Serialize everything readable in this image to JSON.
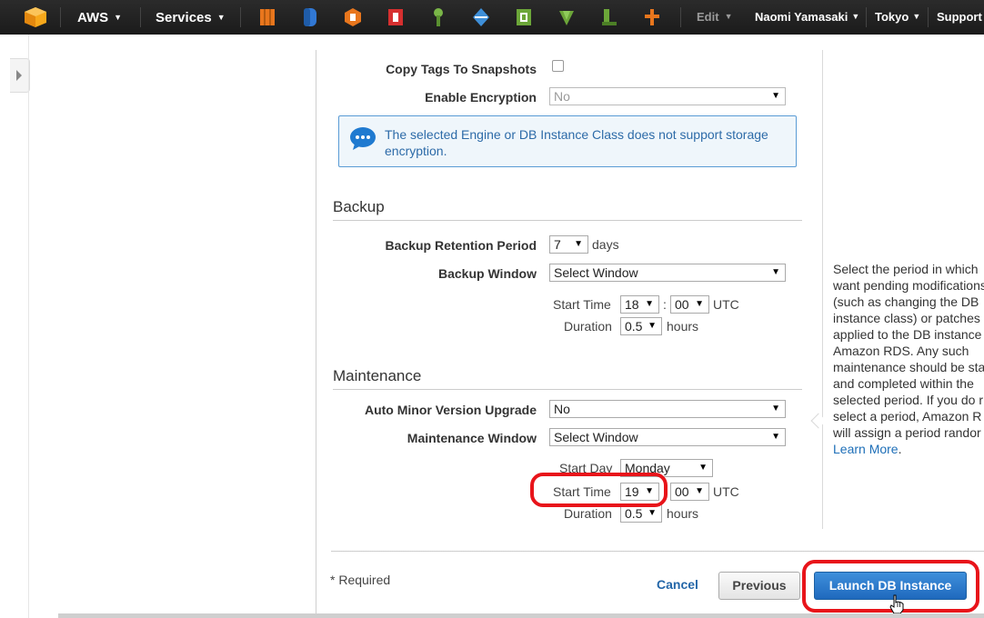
{
  "topnav": {
    "brand": "AWS",
    "services": "Services",
    "edit": "Edit",
    "user": "Naomi Yamasaki",
    "region": "Tokyo",
    "support": "Support"
  },
  "storage": {
    "copy_tags_label": "Copy Tags To Snapshots",
    "encryption_label": "Enable Encryption",
    "encryption_value": "No",
    "info_message": "The selected Engine or DB Instance Class does not support storage encryption."
  },
  "backup": {
    "title": "Backup",
    "retention_label": "Backup Retention Period",
    "retention_value": "7",
    "retention_unit": "days",
    "window_label": "Backup Window",
    "window_value": "Select Window",
    "start_time_label": "Start Time",
    "start_hour": "18",
    "start_minute": "00",
    "tz": "UTC",
    "duration_label": "Duration",
    "duration_value": "0.5",
    "duration_unit": "hours",
    "colon": ":"
  },
  "maintenance": {
    "title": "Maintenance",
    "auto_minor_label": "Auto Minor Version Upgrade",
    "auto_minor_value": "No",
    "window_label": "Maintenance Window",
    "window_value": "Select Window",
    "start_day_label": "Start Day",
    "start_day_value": "Monday",
    "start_time_label": "Start Time",
    "start_hour": "19",
    "start_minute": "00",
    "tz": "UTC",
    "duration_label": "Duration",
    "duration_value": "0.5",
    "duration_unit": "hours"
  },
  "help": {
    "text": "Select the period in which want pending modifications (such as changing the DB instance class) or patches applied to the DB instance Amazon RDS. Any such maintenance should be sta and completed within the selected period. If you do r select a period, Amazon R will assign a period randor",
    "link": "Learn More",
    "period": "."
  },
  "footer": {
    "required": "* Required",
    "cancel": "Cancel",
    "previous": "Previous",
    "launch": "Launch DB Instance"
  },
  "colors": {
    "nav_bg": "#1b1b1b",
    "accent": "#1f69bd",
    "highlight": "#e8141a"
  }
}
